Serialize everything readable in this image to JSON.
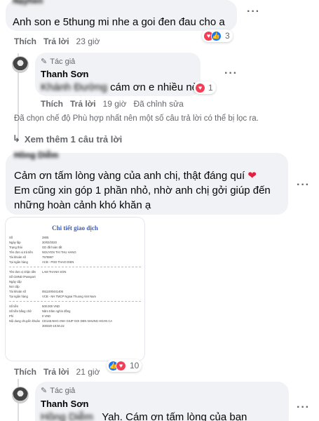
{
  "comment1": {
    "author_blurred": "Nạyhen",
    "text": "Anh son e 5thung mi nhe a goi đen đau cho a",
    "reaction_count": "3",
    "actions": {
      "like": "Thích",
      "reply": "Trả lời",
      "time": "23 giờ"
    }
  },
  "reply1": {
    "author_badge": "Tác giả",
    "author": "Thanh Sơn",
    "mention_blurred": "Khánh Đường",
    "text": "cám ơn e nhiều nè",
    "reaction_count": "1",
    "actions": {
      "like": "Thích",
      "reply": "Trả lời",
      "time": "19 giờ",
      "edited": "Đã chỉnh sửa"
    }
  },
  "filter_notice": "Đã chọn chế độ Phù hợp nhất nên một số câu trả lời có thể bị lọc ra.",
  "more_replies": "Xem thêm 1 câu trả lời",
  "comment2": {
    "author_blurred": "Hồng Diễm",
    "line1": "Cảm ơn tấm lòng vàng của anh chị, thật đáng quí",
    "line2": "Em cũng xin góp 1 phần nhỏ, nhờ anh chị gởi giúp đến",
    "line3": "những hoàn cảnh khó khăn ạ",
    "reaction_count": "10",
    "actions": {
      "like": "Thích",
      "reply": "Trả lời",
      "time": "21 giờ"
    }
  },
  "receipt": {
    "title": "Chi tiết giao dịch",
    "rows1": [
      {
        "k": "Số",
        "v": "2805"
      },
      {
        "k": "Ngày lập",
        "v": "30/03/2020"
      },
      {
        "k": "Trạng thái",
        "v": "GD đã hoàn tất"
      },
      {
        "k": "Tên đơn vị trả tiền",
        "v": "NGUYEN THI THU HANG"
      },
      {
        "k": "Tài khoản số",
        "v": "7578867"
      },
      {
        "k": "Tại ngân hàng",
        "v": "ACB - PGD THAO DIEN"
      }
    ],
    "rows2": [
      {
        "k": "Tên đơn vị nhận tiền",
        "v": "LAM THANH SON"
      },
      {
        "k": "Số CMND /Passport",
        "v": ""
      },
      {
        "k": "Ngày cấp",
        "v": ""
      },
      {
        "k": "Nơi cấp",
        "v": ""
      },
      {
        "k": "Tài khoản số",
        "v": "0511000441405"
      },
      {
        "k": "Tại ngân hàng",
        "v": "VCB - NH TMCP Ngoai Thuong Viet Nam"
      }
    ],
    "rows3": [
      {
        "k": "Số tiền",
        "v": "500.000 VND"
      },
      {
        "k": "Số tiền bằng chữ",
        "v": "Năm trăm nghìn đồng"
      },
      {
        "k": "Phí",
        "v": "0 VND"
      },
      {
        "k": "Nội dung chuyển khoản",
        "v": "CD146.NHO ANH GIUP GOI DEN NHUNG HOAN CA"
      },
      {
        "k": "",
        "v": "300320-19.50.22"
      }
    ]
  },
  "reply2": {
    "author_badge": "Tác giả",
    "author": "Thanh Sơn",
    "mention_blurred": "Hồng Diễm",
    "text": "Yah. Cám ơn tấm lòng của bạn"
  }
}
